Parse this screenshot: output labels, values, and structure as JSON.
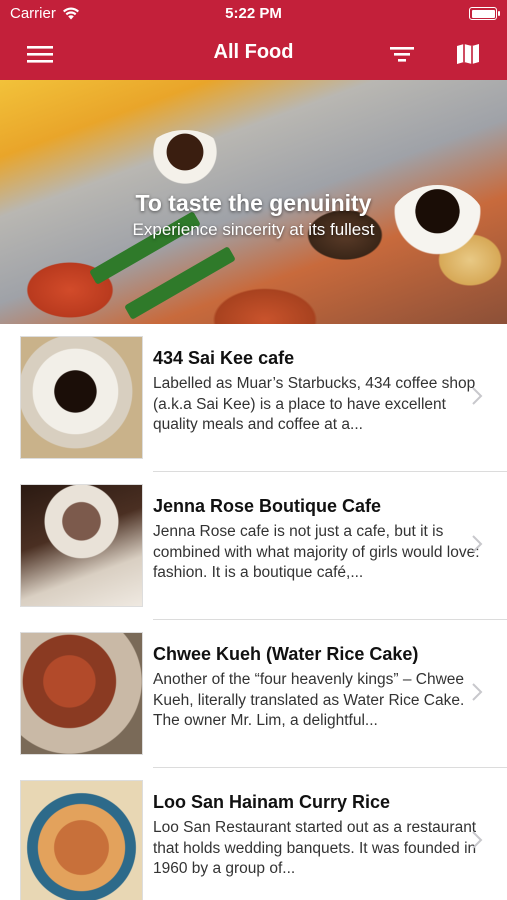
{
  "status_bar": {
    "carrier": "Carrier",
    "time": "5:22 PM"
  },
  "navbar": {
    "title": "All Food",
    "icons": [
      "menu-icon",
      "filter-icon",
      "map-icon"
    ]
  },
  "banner": {
    "title": "To taste the genuinity",
    "subtitle": "Experience sincerity at its fullest"
  },
  "colors": {
    "brand_red": "#c3203a",
    "text_primary": "#111111",
    "text_secondary": "#333333"
  },
  "items": [
    {
      "name": "434 Sai Kee cafe",
      "description": "Labelled as Muar’s Starbucks, 434 coffee shop (a.k.a Sai Kee) is a place to have excellent quality meals and coffee at a..."
    },
    {
      "name": "Jenna Rose Boutique Cafe",
      "description": "Jenna Rose cafe is not just a cafe, but it is combined with what majority of girls would love: fashion. It is a boutique café,..."
    },
    {
      "name": "Chwee Kueh (Water Rice Cake)",
      "description": "Another of the “four heavenly kings” – Chwee Kueh, literally translated as Water Rice Cake. The owner Mr. Lim, a delightful..."
    },
    {
      "name": "Loo San Hainam Curry Rice",
      "description": "Loo San Restaurant started out as a restaurant that holds wedding banquets. It was founded in 1960 by a group of..."
    }
  ]
}
